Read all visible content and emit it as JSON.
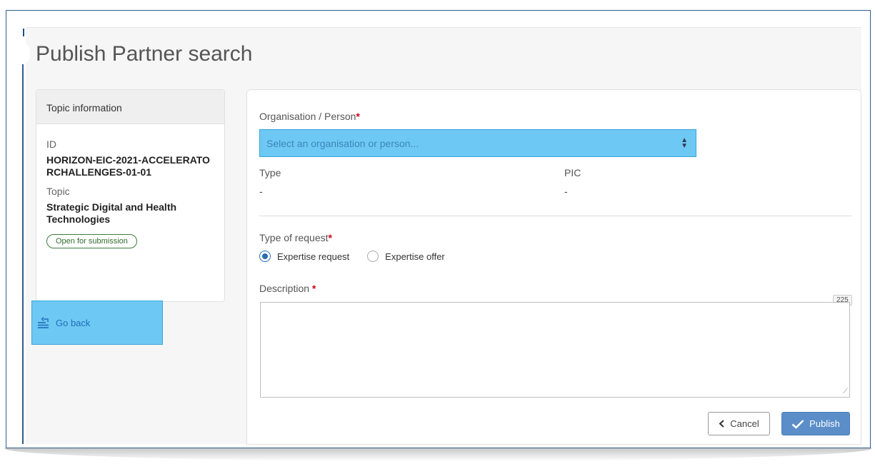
{
  "page": {
    "title": "Publish Partner search"
  },
  "topic_card": {
    "header": "Topic information",
    "id_label": "ID",
    "id_value": "HORIZON-EIC-2021-ACCELERATORCHALLENGES-01-01",
    "topic_label": "Topic",
    "topic_value": "Strategic Digital and Health Technologies",
    "status_badge": "Open for submission"
  },
  "nav": {
    "go_back_label": "Go back",
    "go_back_icon": "list-back-icon"
  },
  "form": {
    "org_label": "Organisation / Person",
    "org_placeholder": "Select an organisation or person...",
    "type_label": "Type",
    "type_value": "-",
    "pic_label": "PIC",
    "pic_value": "-",
    "request_type_label": "Type of request",
    "request_options": [
      {
        "label": "Expertise request",
        "checked": true
      },
      {
        "label": "Expertise offer",
        "checked": false
      }
    ],
    "description_label": "Description",
    "description_counter": "225",
    "description_value": "",
    "required_mark": "*"
  },
  "buttons": {
    "cancel_label": "Cancel",
    "publish_label": "Publish"
  },
  "colors": {
    "highlight": "#6ec8f4",
    "primary_button": "#5b8ec9",
    "required": "#d0021b",
    "badge_green": "#3e7c3e"
  }
}
